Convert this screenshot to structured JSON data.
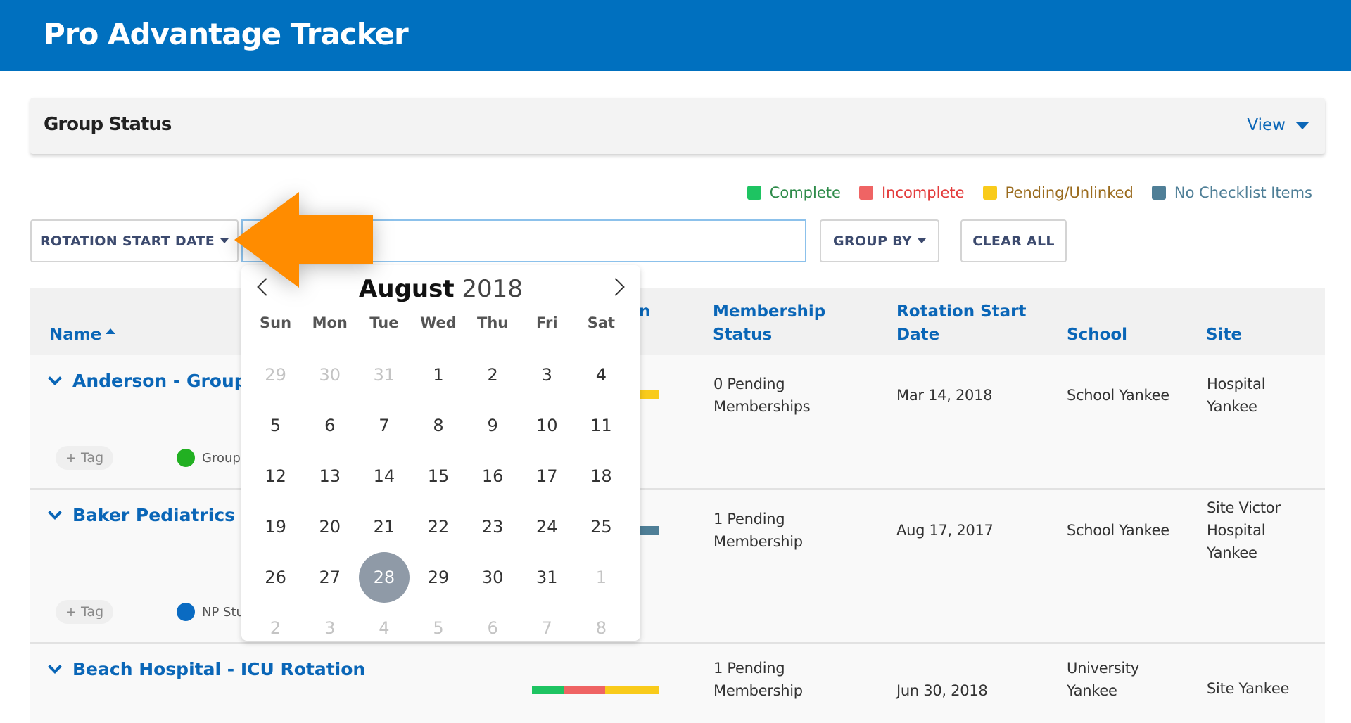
{
  "app": {
    "title": "Pro Advantage Tracker"
  },
  "panel": {
    "title": "Group Status",
    "view_label": "View"
  },
  "legend": [
    {
      "label": "Complete",
      "color": "#1ec462",
      "text_color": "#2e8b4a"
    },
    {
      "label": "Incomplete",
      "color": "#ef6464",
      "text_color": "#e33b3b"
    },
    {
      "label": "Pending/Unlinked",
      "color": "#f9cb1b",
      "text_color": "#9a6b1e"
    },
    {
      "label": "No Checklist Items",
      "color": "#4f7f97",
      "text_color": "#4f7f97"
    }
  ],
  "filters": {
    "rotation_label": "ROTATION START DATE",
    "date_value": "",
    "group_by_label": "GROUP BY",
    "clear_all_label": "CLEAR ALL"
  },
  "table": {
    "columns": {
      "name": "Name",
      "partial": "n",
      "membership": [
        "Membership",
        "Status"
      ],
      "rotation": [
        "Rotation Start",
        "Date"
      ],
      "school": "School",
      "site": "Site"
    },
    "tag_label": "+ Tag",
    "rows": [
      {
        "name": "Anderson - Group",
        "group_tag": "Group",
        "group_color": "#22b022",
        "progress": [
          {
            "status": "Pending/Unlinked",
            "fraction": 1.0,
            "color": "#f9cb1b"
          }
        ],
        "membership": [
          "0 Pending",
          "Memberships"
        ],
        "rotation_date": "Mar 14, 2018",
        "school": [
          "School Yankee"
        ],
        "site": [
          "Hospital",
          "Yankee"
        ]
      },
      {
        "name": "Baker Pediatrics G",
        "group_tag": "NP Stu",
        "group_color": "#0a6bc2",
        "progress": [
          {
            "status": "No Checklist Items",
            "fraction": 1.0,
            "color": "#4f7f97"
          }
        ],
        "membership": [
          "1 Pending",
          "Membership"
        ],
        "rotation_date": "Aug 17, 2017",
        "school": [
          "School Yankee"
        ],
        "site": [
          "Site Victor",
          "Hospital",
          "Yankee"
        ]
      },
      {
        "name": "Beach Hospital - ICU Rotation",
        "progress": [
          {
            "status": "Complete",
            "fraction": 0.25,
            "color": "#1ec462"
          },
          {
            "status": "Incomplete",
            "fraction": 0.33,
            "color": "#ef6464"
          },
          {
            "status": "Pending/Unlinked",
            "fraction": 0.42,
            "color": "#f9cb1b"
          }
        ],
        "membership": [
          "1 Pending",
          "Membership"
        ],
        "rotation_date": "Jun 30, 2018",
        "school": [
          "University",
          "Yankee"
        ],
        "site": [
          "Site Yankee"
        ]
      }
    ]
  },
  "calendar": {
    "month": "August",
    "year": "2018",
    "weekdays": [
      "Sun",
      "Mon",
      "Tue",
      "Wed",
      "Thu",
      "Fri",
      "Sat"
    ],
    "selected_day": "28",
    "weeks": [
      [
        {
          "d": "29",
          "m": true
        },
        {
          "d": "30",
          "m": true
        },
        {
          "d": "31",
          "m": true
        },
        {
          "d": "1"
        },
        {
          "d": "2"
        },
        {
          "d": "3"
        },
        {
          "d": "4"
        }
      ],
      [
        {
          "d": "5"
        },
        {
          "d": "6"
        },
        {
          "d": "7"
        },
        {
          "d": "8"
        },
        {
          "d": "9"
        },
        {
          "d": "10"
        },
        {
          "d": "11"
        }
      ],
      [
        {
          "d": "12"
        },
        {
          "d": "13"
        },
        {
          "d": "14"
        },
        {
          "d": "15"
        },
        {
          "d": "16"
        },
        {
          "d": "17"
        },
        {
          "d": "18"
        }
      ],
      [
        {
          "d": "19"
        },
        {
          "d": "20"
        },
        {
          "d": "21"
        },
        {
          "d": "22"
        },
        {
          "d": "23"
        },
        {
          "d": "24"
        },
        {
          "d": "25"
        }
      ],
      [
        {
          "d": "26"
        },
        {
          "d": "27"
        },
        {
          "d": "28",
          "s": true
        },
        {
          "d": "29"
        },
        {
          "d": "30"
        },
        {
          "d": "31"
        },
        {
          "d": "1",
          "m": true
        }
      ],
      [
        {
          "d": "2",
          "m": true
        },
        {
          "d": "3",
          "m": true
        },
        {
          "d": "4",
          "m": true
        },
        {
          "d": "5",
          "m": true
        },
        {
          "d": "6",
          "m": true
        },
        {
          "d": "7",
          "m": true
        },
        {
          "d": "8",
          "m": true
        }
      ]
    ]
  },
  "annotation": {
    "arrow_color": "#ff8c00",
    "points_to": "rotation-start-date-button"
  }
}
